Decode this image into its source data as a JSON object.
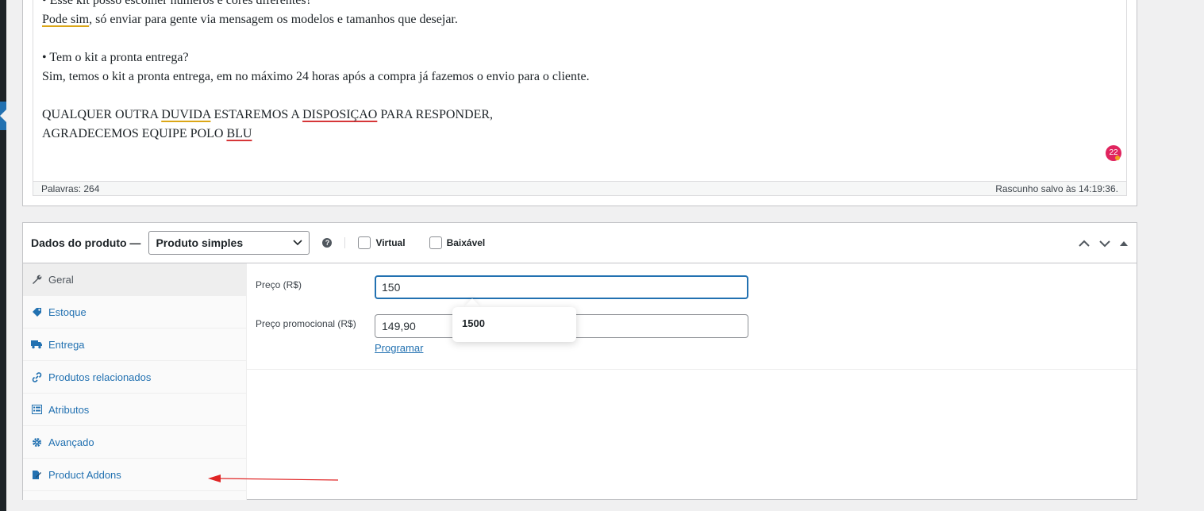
{
  "editor": {
    "lines": [
      "• Esse kit posso escolher números e cores diferentes?",
      "Sim, temos o kit a pronta entrega, em no máximo 24 horas após a compra já fazemos o envio para o cliente.",
      "• Tem o kit a pronta entrega?"
    ],
    "line2_prefix": "Pode sim",
    "line2_rest": ", só enviar para gente via mensagem os modelos e tamanhos que desejar.",
    "line_closing1_a": "QUALQUER OUTRA ",
    "line_closing1_b": "DUVIDA",
    "line_closing1_c": " ESTAREMOS A ",
    "line_closing1_d": "DISPOSIÇAO",
    "line_closing1_e": " PARA RESPONDER,",
    "line_closing2_a": "AGRADECEMOS EQUIPE POLO ",
    "line_closing2_b": "BLU",
    "grammar_count": "22",
    "word_count": "Palavras: 264",
    "draft_status": "Rascunho salvo às 14:19:36."
  },
  "product_data": {
    "title": "Dados do produto —",
    "type_select": "Produto simples",
    "help_glyph": "?",
    "virtual_label": "Virtual",
    "downloadable_label": "Baixável",
    "tabs": [
      {
        "label": "Geral",
        "icon": "wrench-icon"
      },
      {
        "label": "Estoque",
        "icon": "tag-icon"
      },
      {
        "label": "Entrega",
        "icon": "truck-icon"
      },
      {
        "label": "Produtos relacionados",
        "icon": "link-icon"
      },
      {
        "label": "Atributos",
        "icon": "list-icon"
      },
      {
        "label": "Avançado",
        "icon": "gear-icon"
      },
      {
        "label": "Product Addons",
        "icon": "edit-page-icon"
      }
    ],
    "price_label": "Preço (R$)",
    "price_value": "150",
    "sale_price_label": "Preço promocional (R$)",
    "sale_price_value": "149,90",
    "schedule_link": "Programar",
    "autocomplete_suggestion": "1500"
  },
  "colors": {
    "accent": "#2271b1",
    "annotation_arrow": "#e02424"
  }
}
